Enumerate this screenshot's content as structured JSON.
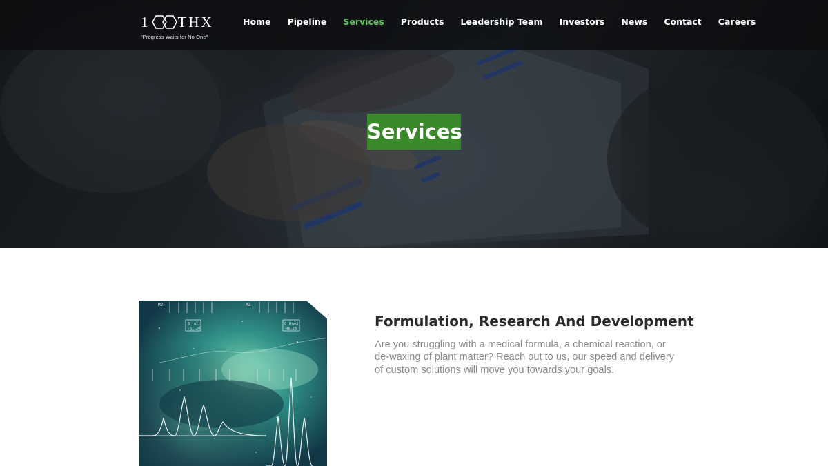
{
  "logo": {
    "text_one": "1",
    "text_rest": "THX",
    "tagline": "\"Progress Waits for No One\""
  },
  "nav": {
    "items": [
      {
        "label": "Home",
        "active": false
      },
      {
        "label": "Pipeline",
        "active": false
      },
      {
        "label": "Services",
        "active": true
      },
      {
        "label": "Products",
        "active": false
      },
      {
        "label": "Leadership Team",
        "active": false
      },
      {
        "label": "Investors",
        "active": false
      },
      {
        "label": "News",
        "active": false
      },
      {
        "label": "Contact",
        "active": false
      },
      {
        "label": "Careers",
        "active": false
      }
    ]
  },
  "hero": {
    "title": "Services"
  },
  "service": {
    "title": "Formulation, Research And Development",
    "description": "Are you struggling with a medical formula, a chemical reaction, or de-waxing of plant matter? Reach out to us, our speed and delivery of custom solutions will move you towards your goals.",
    "image_labels": {
      "peak_left_title": "B (ql)",
      "peak_left_value": "-67.24",
      "peak_right_title": "C (hex)",
      "peak_right_value": "-48.73",
      "marker_m2": "M2",
      "marker_m3": "M3"
    }
  },
  "colors": {
    "accent_green": "#3a8a2b",
    "nav_active": "#5fc35a",
    "nav_bg": "#0c0e10",
    "heading_text": "#2b2b2b",
    "body_text": "#8a8a8a"
  }
}
